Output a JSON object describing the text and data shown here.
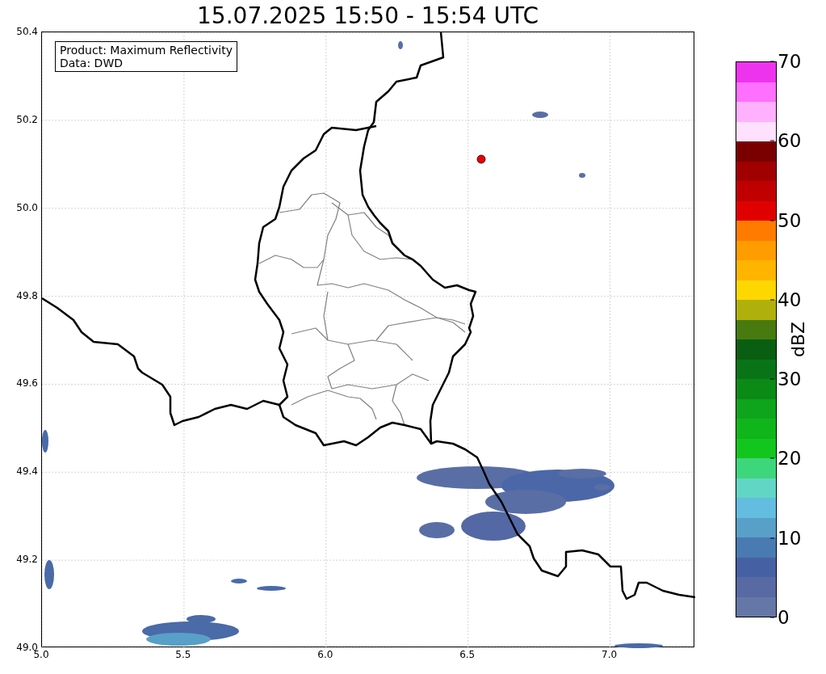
{
  "title": "15.07.2025 15:50 - 15:54 UTC",
  "legend": {
    "lines": [
      "Product: Maximum Reflectivity",
      "Data: DWD"
    ]
  },
  "x_ticks": [
    "5.0",
    "5.5",
    "6.0",
    "6.5",
    "7.0"
  ],
  "y_ticks": [
    "50.4",
    "50.2",
    "50.0",
    "49.8",
    "49.6",
    "49.4",
    "49.2",
    "49.0"
  ],
  "colorbar": {
    "label": "dBZ",
    "ticks": [
      "70",
      "60",
      "50",
      "40",
      "30",
      "20",
      "10",
      "0"
    ],
    "segments": [
      {
        "color": "#6477a6"
      },
      {
        "color": "#5869a3"
      },
      {
        "color": "#4661a3"
      },
      {
        "color": "#4a7ab2"
      },
      {
        "color": "#58a0c8"
      },
      {
        "color": "#62bde0"
      },
      {
        "color": "#62d6c4"
      },
      {
        "color": "#3ed67a"
      },
      {
        "color": "#12c61d"
      },
      {
        "color": "#0fb51a"
      },
      {
        "color": "#0ea41c"
      },
      {
        "color": "#0b8a16"
      },
      {
        "color": "#097417"
      },
      {
        "color": "#095e12"
      },
      {
        "color": "#487a10"
      },
      {
        "color": "#b0b00c"
      },
      {
        "color": "#ffd700"
      },
      {
        "color": "#ffb400"
      },
      {
        "color": "#ff9c00"
      },
      {
        "color": "#ff7b00"
      },
      {
        "color": "#e00000"
      },
      {
        "color": "#c00000"
      },
      {
        "color": "#a00000"
      },
      {
        "color": "#7a0000"
      },
      {
        "color": "#ffe0ff"
      },
      {
        "color": "#ffb0ff"
      },
      {
        "color": "#ff70ff"
      },
      {
        "color": "#ee33ee"
      }
    ]
  }
}
